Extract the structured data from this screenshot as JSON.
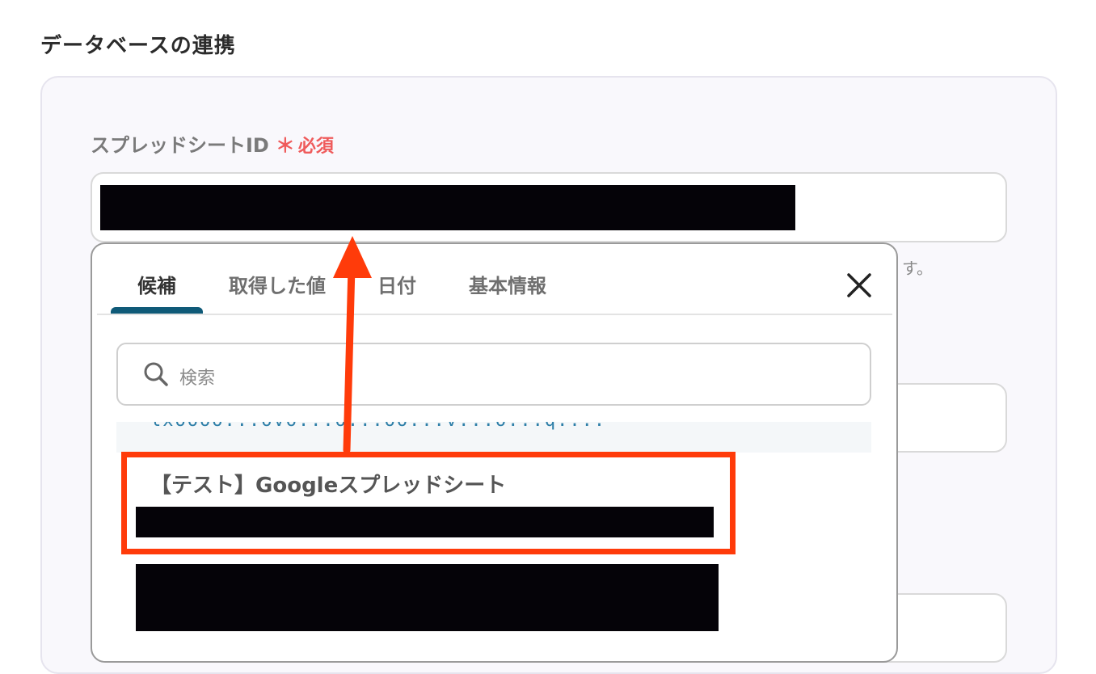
{
  "section": {
    "title": "データベースの連携"
  },
  "field": {
    "label": "スプレッドシートID",
    "required_mark": "＊",
    "required_text": "必須",
    "hint_tail": "す。"
  },
  "popup": {
    "tabs": [
      {
        "label": "候補",
        "active": true
      },
      {
        "label": "取得した値",
        "active": false
      },
      {
        "label": "日付",
        "active": false
      },
      {
        "label": "基本情報",
        "active": false
      }
    ],
    "close_icon": "close-icon",
    "search": {
      "placeholder": "検索",
      "icon": "search-icon"
    },
    "partial_item_text": "lxoooo...ovo...o...oo...v...o...q...."
  },
  "list": {
    "highlighted_item_title": "【テスト】Googleスプレッドシート"
  },
  "colors": {
    "accent_tab": "#0f5a78",
    "required": "#ef5b5b",
    "annotation": "#ff3b0a",
    "link": "#2e7fa8"
  }
}
